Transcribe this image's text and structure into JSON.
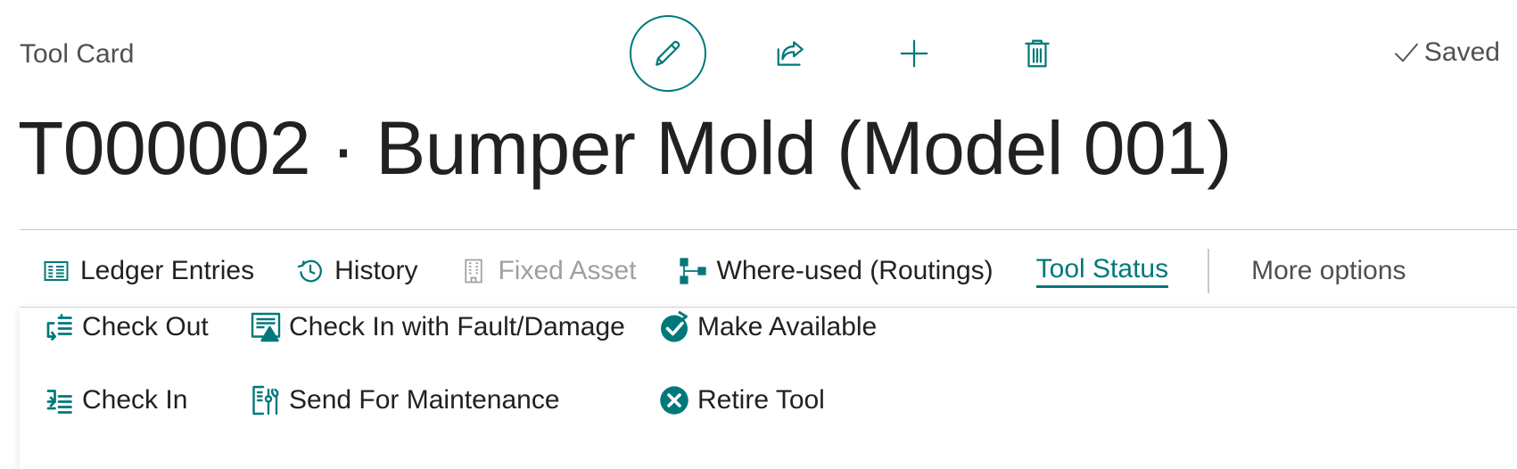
{
  "header": {
    "caption": "Tool Card",
    "status": "Saved",
    "buttons": {
      "edit": "pencil-icon",
      "share": "share-icon",
      "new": "plus-icon",
      "delete": "trash-icon"
    }
  },
  "title": "T000002 · Bumper Mold (Model 001)",
  "action_bar": {
    "items": [
      {
        "label": "Ledger Entries",
        "icon": "ledger-icon",
        "state": "enabled"
      },
      {
        "label": "History",
        "icon": "history-icon",
        "state": "enabled"
      },
      {
        "label": "Fixed Asset",
        "icon": "building-icon",
        "state": "disabled"
      },
      {
        "label": "Where-used (Routings)",
        "icon": "routing-icon",
        "state": "enabled"
      },
      {
        "label": "Tool Status",
        "icon": "",
        "state": "active"
      },
      {
        "label": "More options",
        "icon": "",
        "state": "enabled"
      }
    ]
  },
  "tool_status_menu": {
    "items": [
      {
        "label": "Check Out",
        "icon": "check-out-icon"
      },
      {
        "label": "Check In",
        "icon": "check-in-icon"
      },
      {
        "label": "Check In with Fault/Damage",
        "icon": "fault-damage-icon"
      },
      {
        "label": "Send For Maintenance",
        "icon": "maintenance-icon"
      },
      {
        "label": "Make Available",
        "icon": "make-available-icon"
      },
      {
        "label": "Retire Tool",
        "icon": "retire-icon"
      }
    ]
  },
  "colors": {
    "accent": "#00787a",
    "text": "#212121",
    "muted": "#505050",
    "disabled": "#a0a0a0"
  }
}
